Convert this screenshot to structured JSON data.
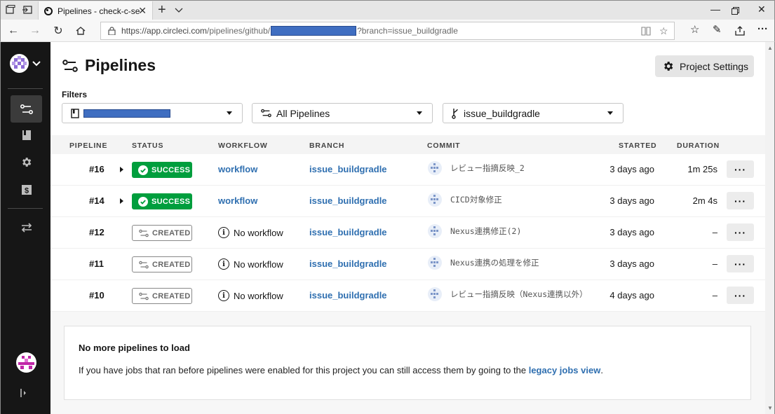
{
  "browser": {
    "tab_title": "Pipelines - check-c-sear",
    "url_prefix": "https://app.circleci.com",
    "url_path": "/pipelines/github/",
    "url_suffix": "?branch=issue_buildgradle"
  },
  "page": {
    "title": "Pipelines",
    "project_settings_label": "Project Settings",
    "filters_label": "Filters",
    "filter_pipelines": "All Pipelines",
    "filter_branch": "issue_buildgradle"
  },
  "table": {
    "headers": {
      "pipeline": "PIPELINE",
      "status": "STATUS",
      "workflow": "WORKFLOW",
      "branch": "BRANCH",
      "commit": "COMMIT",
      "started": "STARTED",
      "duration": "DURATION"
    },
    "rows": [
      {
        "num": "#16",
        "status": "SUCCESS",
        "workflow": "workflow",
        "branch": "issue_buildgradle",
        "commit": "レビュー指摘反映_2",
        "started": "3 days ago",
        "duration": "1m 25s",
        "more": "···"
      },
      {
        "num": "#14",
        "status": "SUCCESS",
        "workflow": "workflow",
        "branch": "issue_buildgradle",
        "commit": "CICD対象修正",
        "started": "3 days ago",
        "duration": "2m 4s",
        "more": "···"
      },
      {
        "num": "#12",
        "status": "CREATED",
        "workflow": "No workflow",
        "branch": "issue_buildgradle",
        "commit": "Nexus連携修正(2)",
        "started": "3 days ago",
        "duration": "–",
        "more": "···"
      },
      {
        "num": "#11",
        "status": "CREATED",
        "workflow": "No workflow",
        "branch": "issue_buildgradle",
        "commit": "Nexus連携の処理を修正",
        "started": "3 days ago",
        "duration": "–",
        "more": "···"
      },
      {
        "num": "#10",
        "status": "CREATED",
        "workflow": "No workflow",
        "branch": "issue_buildgradle",
        "commit": "レビュー指摘反映（Nexus連携以外）",
        "started": "4 days ago",
        "duration": "–",
        "more": "···"
      }
    ]
  },
  "empty_state": {
    "title": "No more pipelines to load",
    "text_before": "If you have jobs that ran before pipelines were enabled for this project you can still access them by going to the ",
    "link": "legacy jobs view",
    "text_after": "."
  },
  "colors": {
    "success": "#009e3d",
    "link": "#2f6fb0",
    "sidebar": "#161616",
    "redaction": "#3f6ec1"
  }
}
